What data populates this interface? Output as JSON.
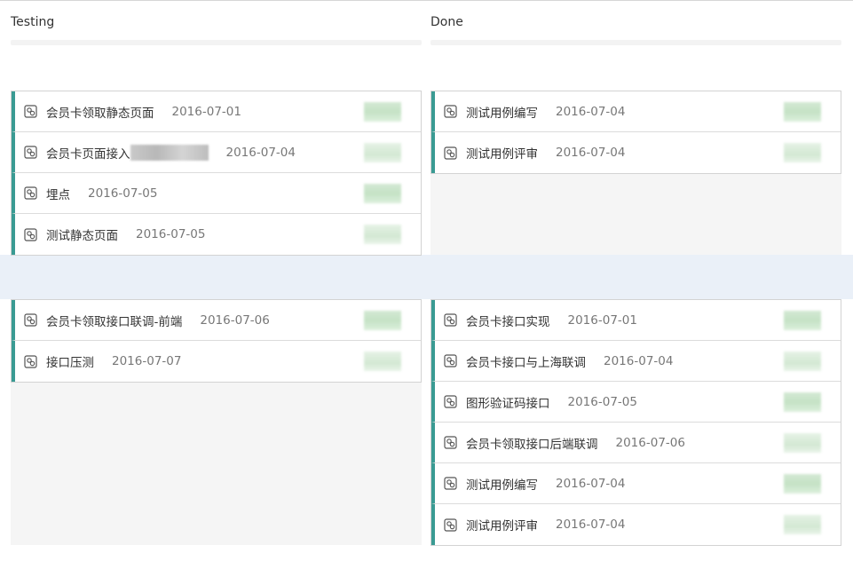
{
  "columns": [
    {
      "name": "Testing"
    },
    {
      "name": "Done"
    }
  ],
  "swimlanes": [
    {
      "testing": [
        {
          "title": "会员卡领取静态页面",
          "date": "2016-07-01"
        },
        {
          "title": "会员卡页面接入",
          "date": "2016-07-04",
          "redacted": true
        },
        {
          "title": "埋点",
          "date": "2016-07-05"
        },
        {
          "title": "测试静态页面",
          "date": "2016-07-05"
        }
      ],
      "done": [
        {
          "title": "测试用例编写",
          "date": "2016-07-04"
        },
        {
          "title": "测试用例评审",
          "date": "2016-07-04"
        }
      ]
    },
    {
      "testing": [
        {
          "title": "会员卡领取接口联调-前端",
          "date": "2016-07-06"
        },
        {
          "title": "接口压测",
          "date": "2016-07-07"
        }
      ],
      "done": [
        {
          "title": "会员卡接口实现",
          "date": "2016-07-01"
        },
        {
          "title": "会员卡接口与上海联调",
          "date": "2016-07-04"
        },
        {
          "title": "图形验证码接口",
          "date": "2016-07-05"
        },
        {
          "title": "会员卡领取接口后端联调",
          "date": "2016-07-06"
        },
        {
          "title": "测试用例编写",
          "date": "2016-07-04"
        },
        {
          "title": "测试用例评审",
          "date": "2016-07-04"
        }
      ]
    }
  ],
  "icons": {
    "card": "card-type-icon"
  },
  "colors": {
    "card_accent": "#3a9b93",
    "divider": "#eaf0f8",
    "lane_bg": "#f5f5f5"
  }
}
